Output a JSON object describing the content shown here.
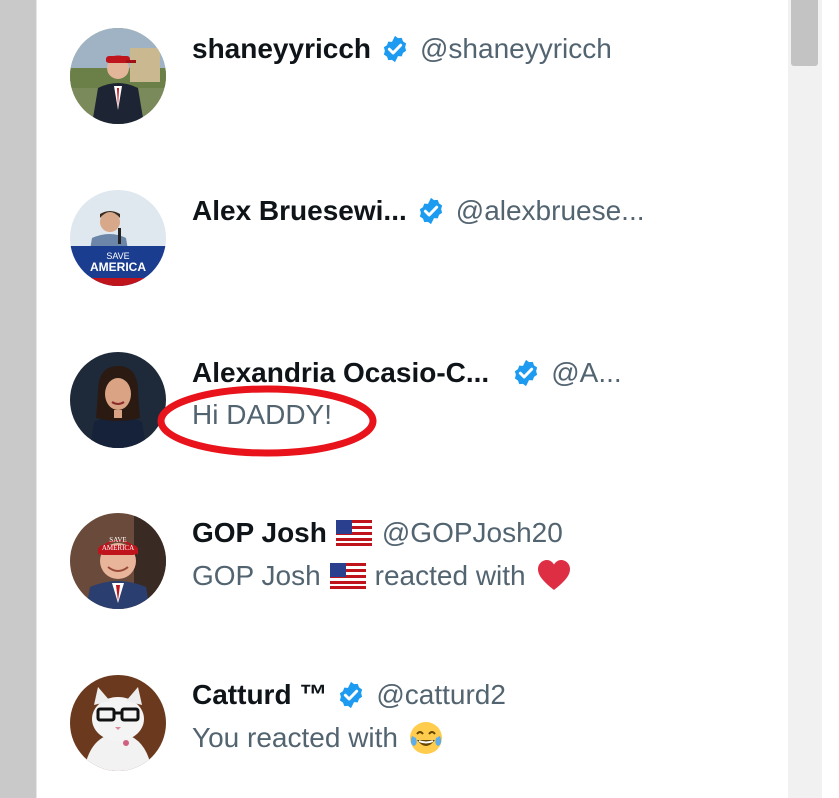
{
  "notifications": [
    {
      "display_name": "shaneyyricch",
      "handle": "@shaneyyricch",
      "verified": true,
      "avatar_icon": "person-red-cap-avatar"
    },
    {
      "display_name": "Alex Bruesewi...",
      "handle": "@alexbruese...",
      "verified": true,
      "avatar_icon": "person-podium-save-america-avatar",
      "avatar_sign_text_1": "SAVE",
      "avatar_sign_text_2": "AMERICA"
    },
    {
      "display_name": "Alexandria Ocasio-C...",
      "handle": "@A...",
      "verified": true,
      "avatar_icon": "woman-portrait-avatar",
      "message": "Hi DADDY!",
      "annotation": "red-circle-highlight"
    },
    {
      "display_name": "GOP Josh",
      "handle": "@GOPJosh20",
      "verified": false,
      "avatar_icon": "person-save-america-cap-avatar",
      "avatar_cap_text_1": "SAVE",
      "avatar_cap_text_2": "AMERICA",
      "reaction_prefix": "GOP Josh",
      "reaction_suffix": "reacted with",
      "reaction_icon": "red-heart-icon"
    },
    {
      "display_name": "Catturd ™",
      "handle": "@catturd2",
      "verified": true,
      "avatar_icon": "cat-glasses-avatar",
      "reaction_text": "You reacted with",
      "reaction_icon": "tears-of-joy-emoji-icon"
    }
  ],
  "colors": {
    "verified_blue": "#1d9bf0",
    "name_text": "#0f1419",
    "secondary_text": "#536471",
    "annotation_red": "#e8131b"
  }
}
